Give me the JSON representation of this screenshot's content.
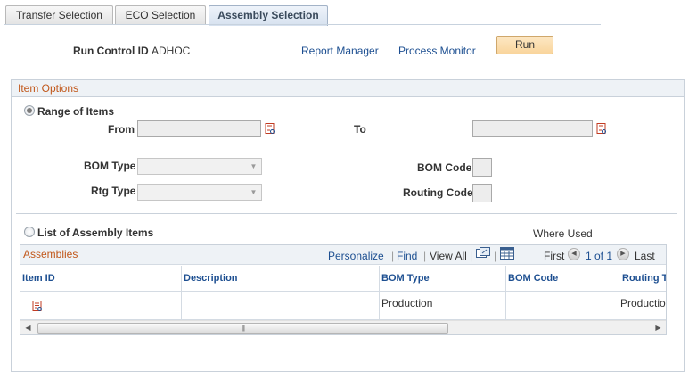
{
  "tabs": [
    {
      "label": "Transfer Selection"
    },
    {
      "label": "ECO Selection"
    },
    {
      "label": "Assembly Selection"
    }
  ],
  "header": {
    "run_control_label": "Run Control ID",
    "run_control_value": "ADHOC",
    "report_manager": "Report Manager",
    "process_monitor": "Process Monitor",
    "run_button": "Run"
  },
  "item_options": {
    "title": "Item Options",
    "range_label": "Range of Items",
    "from_label": "From",
    "to_label": "To",
    "from_value": "",
    "to_value": "",
    "bom_type_label": "BOM Type",
    "rtg_type_label": "Rtg Type",
    "bom_code_label": "BOM Code",
    "routing_code_label": "Routing Code",
    "list_label": "List of Assembly Items",
    "where_used": "Where Used"
  },
  "grid": {
    "title": "Assemblies",
    "personalize": "Personalize",
    "find": "Find",
    "view_all": "View All",
    "first": "First",
    "pager": "1 of 1",
    "last": "Last",
    "columns": [
      "Item ID",
      "Description",
      "BOM Type",
      "BOM Code",
      "Routing T"
    ],
    "rows": [
      {
        "item_id": "",
        "description": "",
        "bom_type": "Production",
        "bom_code": "",
        "routing_type": "Productio"
      }
    ]
  },
  "colors": {
    "accent_link": "#1d4f91",
    "section_title": "#c1571a",
    "run_button_bg": "#f9d59c"
  }
}
